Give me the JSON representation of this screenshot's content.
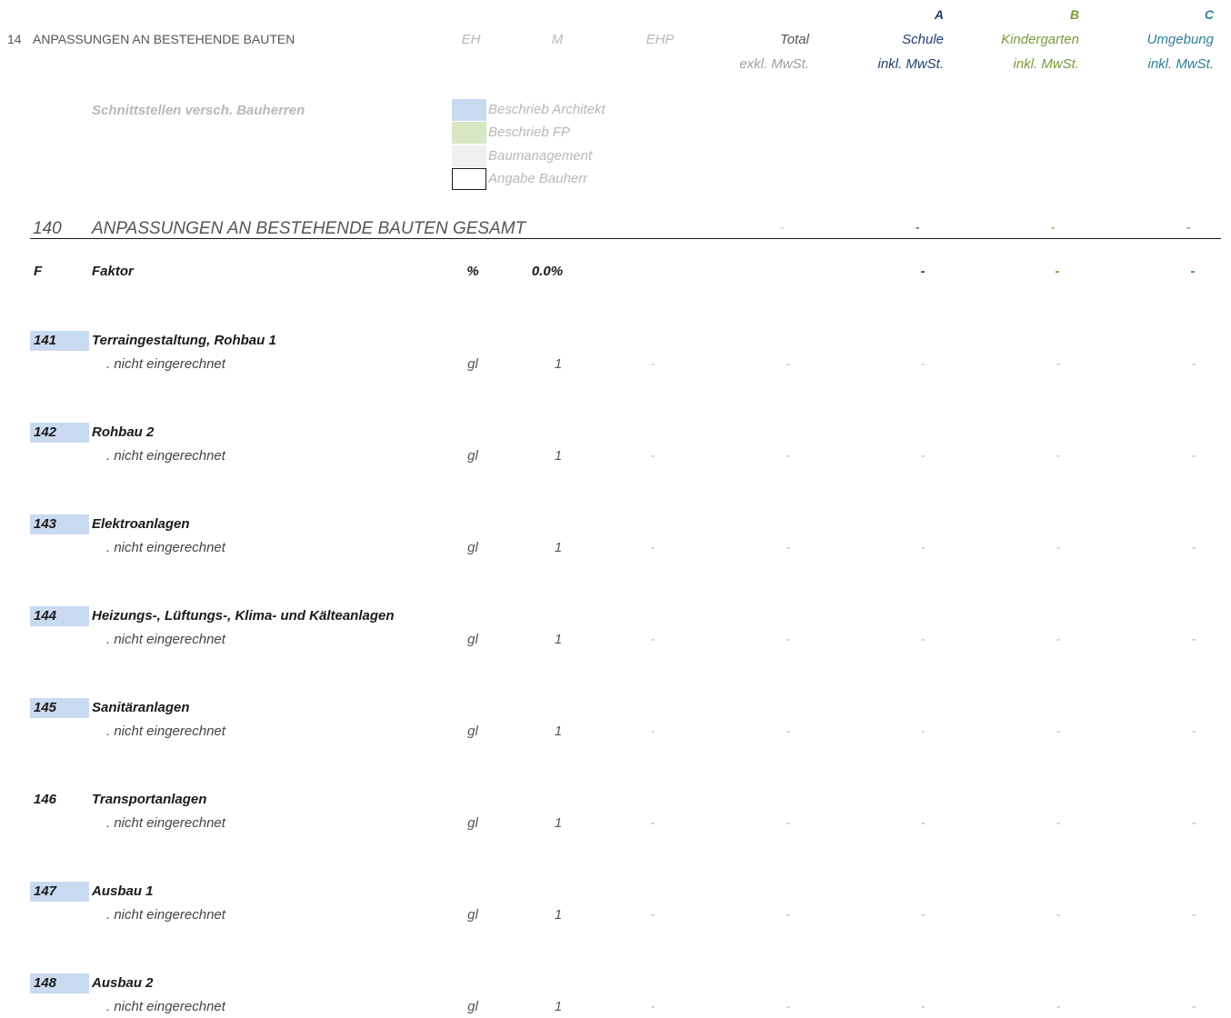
{
  "header": {
    "section_code": "14",
    "section_title": "ANPASSUNGEN AN BESTEHENDE BAUTEN",
    "col_eh": "EH",
    "col_m": "M",
    "col_ehp": "EHP",
    "col_total": "Total",
    "col_total_sub": "exkl. MwSt.",
    "col_a_letter": "A",
    "col_a_name": "Schule",
    "col_a_sub": "inkl. MwSt.",
    "col_b_letter": "B",
    "col_b_name": "Kindergarten",
    "col_b_sub": "inkl. MwSt.",
    "col_c_letter": "C",
    "col_c_name": "Umgebung",
    "col_c_sub": "inkl. MwSt."
  },
  "legend": {
    "title": "Schnittstellen versch. Bauherren",
    "items": [
      {
        "label": "Beschrieb Architekt",
        "color": "#c9daf0"
      },
      {
        "label": "Beschrieb FP",
        "color": "#d8e6c4"
      },
      {
        "label": "Baumanagement",
        "color": "#f0f0f0"
      },
      {
        "label": "Angabe Bauherr",
        "color": "#ffffff"
      }
    ]
  },
  "total_row": {
    "code": "140",
    "label": "ANPASSUNGEN AN BESTEHENDE BAUTEN GESAMT",
    "total": "-",
    "a": "-",
    "b": "-",
    "c": "-"
  },
  "factor_row": {
    "code": "F",
    "label": "Faktor",
    "unit": "%",
    "value": "0.0%",
    "a": "-",
    "b": "-",
    "c": "-"
  },
  "items": [
    {
      "code": "141",
      "title": "Terraingestaltung, Rohbau 1",
      "highlight": true,
      "sub": ". nicht eingerechnet",
      "unit": "gl",
      "qty": "1",
      "ehp": "-",
      "total": "-",
      "a": "-",
      "b": "-",
      "c": "-"
    },
    {
      "code": "142",
      "title": "Rohbau 2",
      "highlight": true,
      "sub": ". nicht eingerechnet",
      "unit": "gl",
      "qty": "1",
      "ehp": "-",
      "total": "-",
      "a": "-",
      "b": "-",
      "c": "-"
    },
    {
      "code": "143",
      "title": "Elektroanlagen",
      "highlight": true,
      "sub": ". nicht eingerechnet",
      "unit": "gl",
      "qty": "1",
      "ehp": "-",
      "total": "-",
      "a": "-",
      "b": "-",
      "c": "-"
    },
    {
      "code": "144",
      "title": "Heizungs-, Lüftungs-, Klima- und Kälteanlagen",
      "highlight": true,
      "sub": ". nicht eingerechnet",
      "unit": "gl",
      "qty": "1",
      "ehp": "-",
      "total": "-",
      "a": "-",
      "b": "-",
      "c": "-"
    },
    {
      "code": "145",
      "title": "Sanitäranlagen",
      "highlight": true,
      "sub": ". nicht eingerechnet",
      "unit": "gl",
      "qty": "1",
      "ehp": "-",
      "total": "-",
      "a": "-",
      "b": "-",
      "c": "-"
    },
    {
      "code": "146",
      "title": "Transportanlagen",
      "highlight": false,
      "sub": ". nicht eingerechnet",
      "unit": "gl",
      "qty": "1",
      "ehp": "-",
      "total": "-",
      "a": "-",
      "b": "-",
      "c": "-"
    },
    {
      "code": "147",
      "title": "Ausbau 1",
      "highlight": true,
      "sub": ". nicht eingerechnet",
      "unit": "gl",
      "qty": "1",
      "ehp": "-",
      "total": "-",
      "a": "-",
      "b": "-",
      "c": "-"
    },
    {
      "code": "148",
      "title": "Ausbau 2",
      "highlight": true,
      "sub": ". nicht eingerechnet",
      "unit": "gl",
      "qty": "1",
      "ehp": "-",
      "total": "-",
      "a": "-",
      "b": "-",
      "c": "-"
    }
  ]
}
